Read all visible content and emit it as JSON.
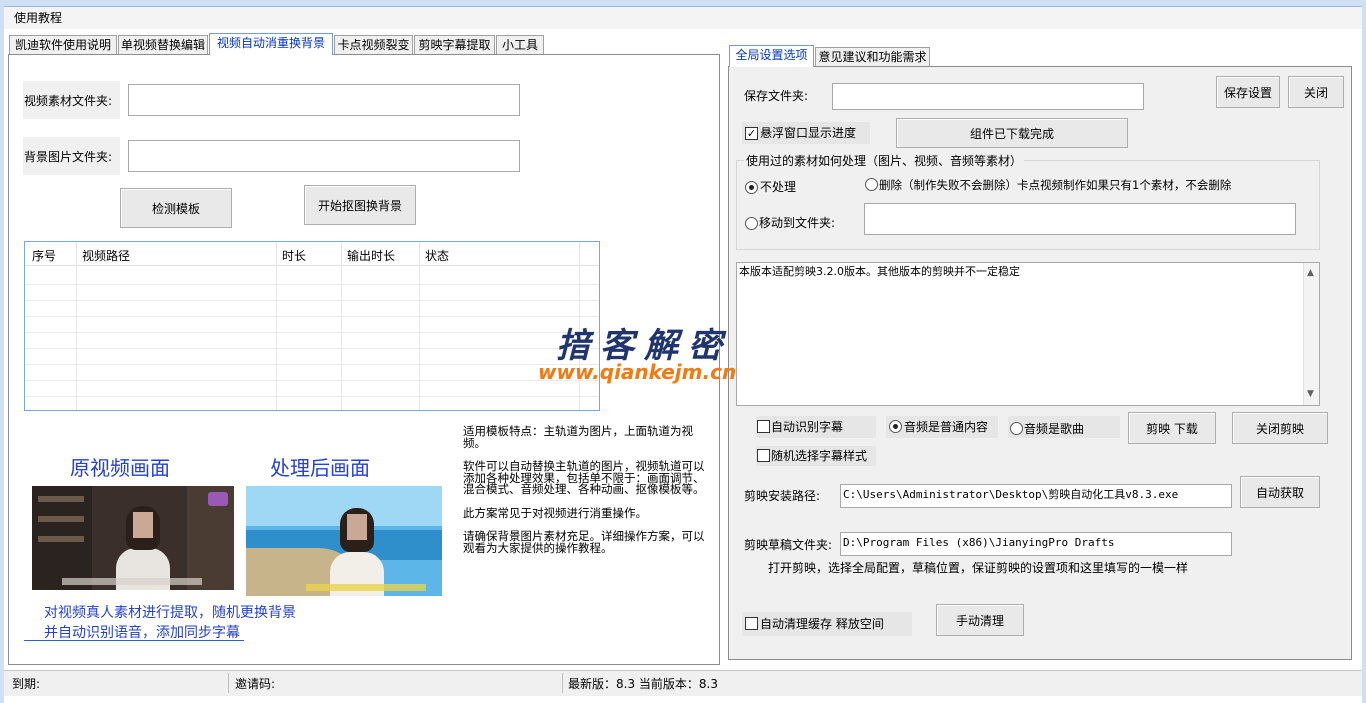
{
  "menu": {
    "item": "使用教程"
  },
  "left_tabs": [
    "凯迪软件使用说明",
    "单视频替换编辑",
    "视频自动消重换背景",
    "卡点视频裂变",
    "剪映字幕提取",
    "小工具"
  ],
  "right_tabs": [
    "全局设置选项",
    "意见建议和功能需求"
  ],
  "left": {
    "video_folder_label": "视频素材文件夹:",
    "video_folder_value": "",
    "bg_folder_label": "背景图片文件夹:",
    "bg_folder_value": "",
    "detect_button": "检测模板",
    "start_button": "开始抠图换背景",
    "table_headers": [
      "序号",
      "视频路径",
      "时长",
      "输出时长",
      "状态"
    ],
    "promo": {
      "title_original": "原视频画面",
      "title_processed": "处理后画面",
      "caption_line1": "对视频真人素材进行提取，随机更换背景",
      "caption_line2": "并自动识别语音，添加同步字幕"
    },
    "description": [
      "适用模板特点：主轨道为图片，上面轨道为视频。",
      "软件可以自动替换主轨道的图片，视频轨道可以添加各种处理效果，包括单不限于：画面调节、混合模式、音频处理、各种动画、抠像模板等。",
      "此方案常见于对视频进行消重操作。",
      "请确保背景图片素材充足。详细操作方案，可以观看为大家提供的操作教程。"
    ]
  },
  "right": {
    "save_folder_label": "保存文件夹:",
    "save_folder_value": "",
    "save_settings_button": "保存设置",
    "close_button": "关闭",
    "float_progress_label": "悬浮窗口显示进度",
    "float_progress_checked": true,
    "components_button": "组件已下载完成",
    "group_title": "使用过的素材如何处理（图片、视频、音频等素材）",
    "radio_none": "不处理",
    "radio_delete": "删除（制作失败不会删除）卡点视频制作如果只有1个素材，不会删除",
    "radio_move": "移动到文件夹:",
    "move_folder_value": "",
    "notice_text": "本版本适配剪映3.2.0版本。其他版本的剪映并不一定稳定",
    "auto_subtitle_label": "自动识别字幕",
    "audio_normal_label": "音频是普通内容",
    "audio_song_label": "音频是歌曲",
    "jianying_download_button": "剪映 下载",
    "close_jianying_button": "关闭剪映",
    "random_subtitle_label": "随机选择字幕样式",
    "install_path_label": "剪映安装路径:",
    "install_path_value": "C:\\Users\\Administrator\\Desktop\\剪映自动化工具v8.3.exe",
    "auto_get_button": "自动获取",
    "draft_folder_label": "剪映草稿文件夹:",
    "draft_folder_value": "D:\\Program Files (x86)\\JianyingPro Drafts",
    "draft_hint": "打开剪映，选择全局配置，草稿位置，保证剪映的设置项和这里填写的一模一样",
    "auto_clean_label": "自动清理缓存 释放空间",
    "manual_clean_button": "手动清理"
  },
  "status": {
    "expire_label": "到期:",
    "invite_label": "邀请码:",
    "version_text": "最新版：8.3 当前版本：8.3"
  },
  "watermark": {
    "cn": "揞客解密",
    "url": "www.qiankejm.cn"
  }
}
